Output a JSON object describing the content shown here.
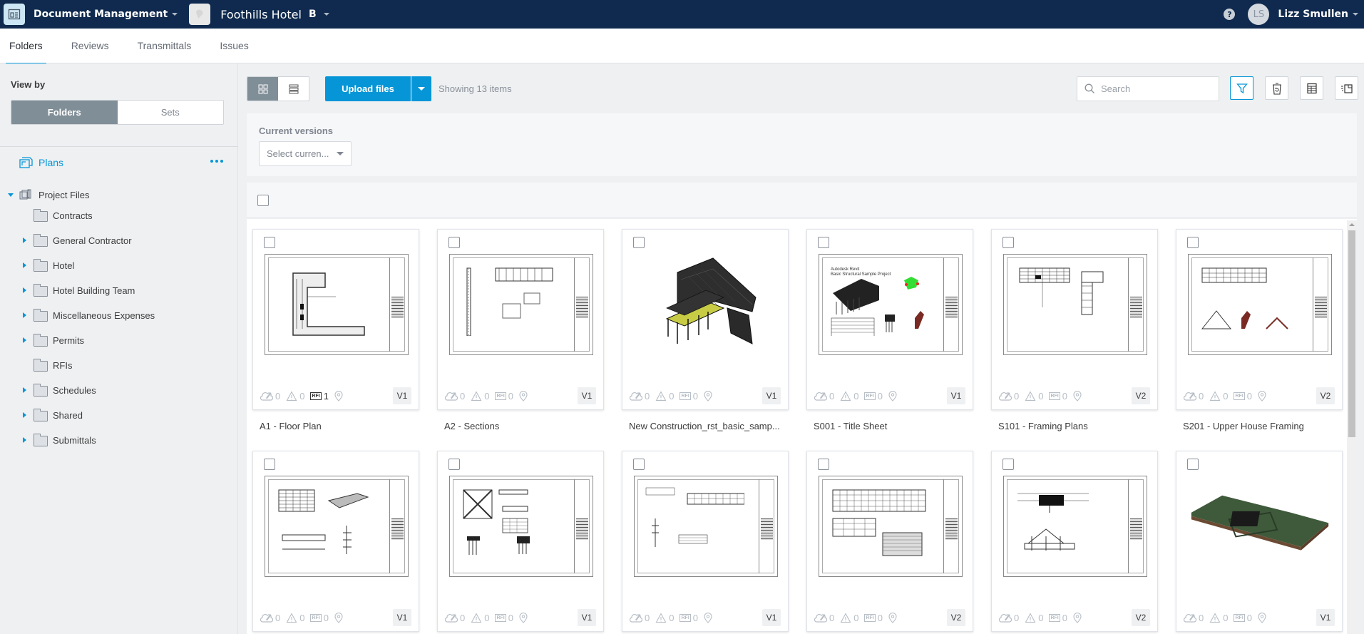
{
  "topbar": {
    "app_name": "Document Management",
    "project_name": "Foothills Hotel",
    "project_badge": "B",
    "help_label": "?",
    "user_initials": "LS",
    "user_name": "Lizz Smullen"
  },
  "tabs": [
    {
      "label": "Folders",
      "active": true
    },
    {
      "label": "Reviews",
      "active": false
    },
    {
      "label": "Transmittals",
      "active": false
    },
    {
      "label": "Issues",
      "active": false
    }
  ],
  "sidebar": {
    "view_by_label": "View by",
    "segments": [
      "Folders",
      "Sets"
    ],
    "active_segment": "Folders",
    "plans_label": "Plans",
    "root": {
      "label": "Project Files",
      "expanded": true
    },
    "folders": [
      {
        "label": "Contracts",
        "expandable": false
      },
      {
        "label": "General Contractor",
        "expandable": true
      },
      {
        "label": "Hotel",
        "expandable": true
      },
      {
        "label": "Hotel Building Team",
        "expandable": true
      },
      {
        "label": "Miscellaneous Expenses",
        "expandable": true
      },
      {
        "label": "Permits",
        "expandable": true
      },
      {
        "label": "RFIs",
        "expandable": false
      },
      {
        "label": "Schedules",
        "expandable": true
      },
      {
        "label": "Shared",
        "expandable": true
      },
      {
        "label": "Submittals",
        "expandable": true
      }
    ]
  },
  "toolbar": {
    "upload_label": "Upload files",
    "showing_text": "Showing 13 items",
    "search_placeholder": "Search",
    "active_view": "grid"
  },
  "filters": {
    "current_versions_label": "Current versions",
    "current_versions_placeholder": "Select curren..."
  },
  "files": [
    {
      "name": "A1 - Floor Plan",
      "markups": "0",
      "issues": "0",
      "rfis": "1",
      "version": "V1",
      "thumb": "floorplan"
    },
    {
      "name": "A2 - Sections",
      "markups": "0",
      "issues": "0",
      "rfis": "0",
      "version": "V1",
      "thumb": "sections"
    },
    {
      "name": "New Construction_rst_basic_samp...",
      "markups": "0",
      "issues": "0",
      "rfis": "0",
      "version": "V1",
      "thumb": "model3d"
    },
    {
      "name": "S001 - Title Sheet",
      "markups": "0",
      "issues": "0",
      "rfis": "0",
      "version": "V1",
      "thumb": "titlesheet"
    },
    {
      "name": "S101 - Framing Plans",
      "markups": "0",
      "issues": "0",
      "rfis": "0",
      "version": "V2",
      "thumb": "framing"
    },
    {
      "name": "S201 - Upper House Framing",
      "markups": "0",
      "issues": "0",
      "rfis": "0",
      "version": "V2",
      "thumb": "upper"
    },
    {
      "name": "",
      "markups": "0",
      "issues": "0",
      "rfis": "0",
      "version": "V1",
      "thumb": "elevation"
    },
    {
      "name": "",
      "markups": "0",
      "issues": "0",
      "rfis": "0",
      "version": "V1",
      "thumb": "foundation"
    },
    {
      "name": "",
      "markups": "0",
      "issues": "0",
      "rfis": "0",
      "version": "V1",
      "thumb": "schedule"
    },
    {
      "name": "",
      "markups": "0",
      "issues": "0",
      "rfis": "0",
      "version": "V2",
      "thumb": "grid"
    },
    {
      "name": "",
      "markups": "0",
      "issues": "0",
      "rfis": "0",
      "version": "V2",
      "thumb": "section2"
    },
    {
      "name": "",
      "markups": "0",
      "issues": "0",
      "rfis": "0",
      "version": "V1",
      "thumb": "site"
    }
  ]
}
